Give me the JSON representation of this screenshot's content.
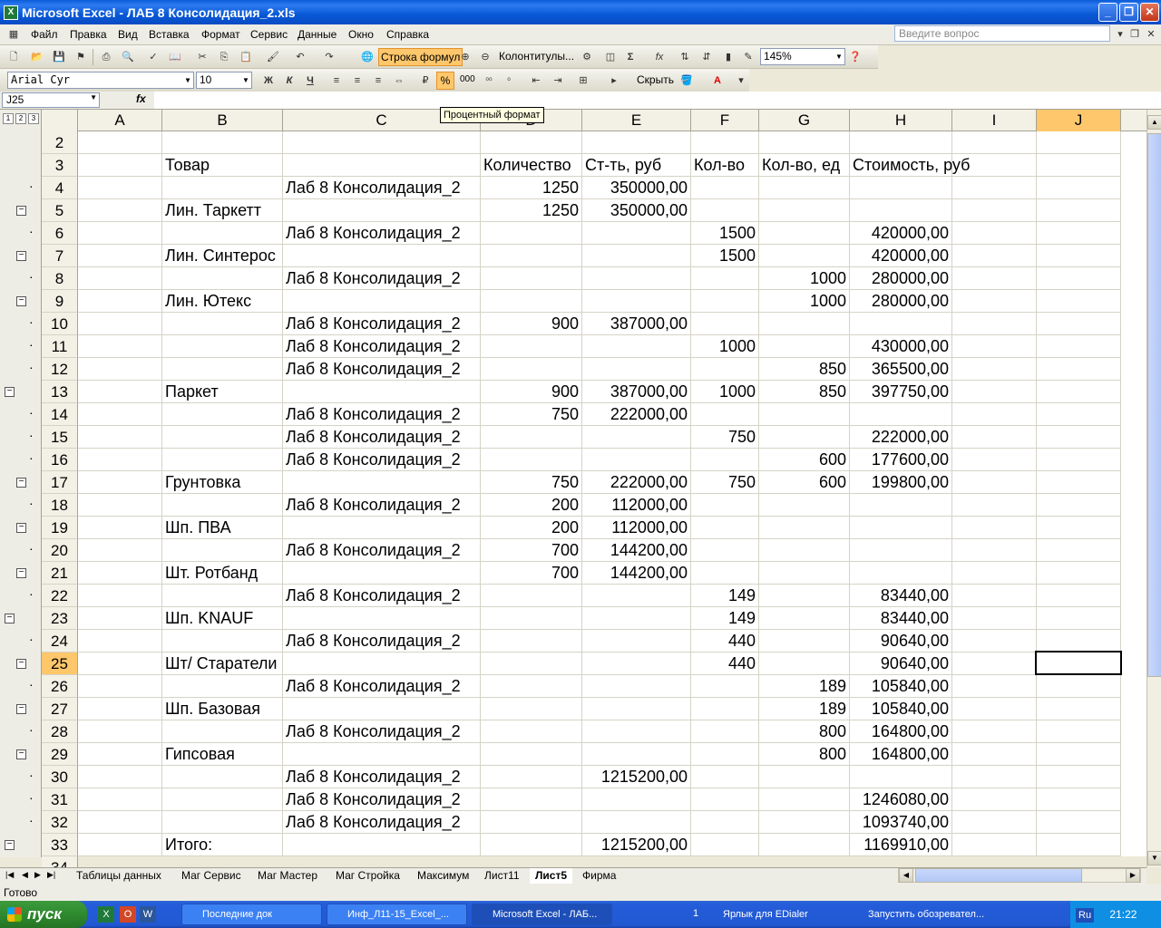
{
  "window": {
    "title": "Microsoft Excel - ЛАБ 8 Консолидация_2.xls"
  },
  "menu": {
    "items": [
      "Файл",
      "Правка",
      "Вид",
      "Вставка",
      "Формат",
      "Сервис",
      "Данные",
      "Окно",
      "Справка"
    ],
    "help_placeholder": "Введите вопрос"
  },
  "toolbar1": {
    "formula_bar_button": "Строка формул",
    "header_footer_button": "Колонтитулы...",
    "zoom": "145%"
  },
  "toolbar2": {
    "font_name": "Arial Cyr",
    "font_size": "10",
    "hide_button": "Скрыть",
    "percent_button": "%",
    "thousands_button": "000"
  },
  "formula_bar": {
    "name_box": "J25",
    "fx": "fx",
    "formula": ""
  },
  "tooltip": "Процентный формат",
  "outline_levels": [
    "1",
    "2",
    "3"
  ],
  "columns": [
    "A",
    "B",
    "C",
    "D",
    "E",
    "F",
    "G",
    "H",
    "I",
    "J"
  ],
  "rows": [
    {
      "n": "2",
      "B": "",
      "C": "",
      "D": "",
      "E": "",
      "F": "",
      "G": "",
      "H": ""
    },
    {
      "n": "3",
      "B": "Товар",
      "C": "",
      "D": "Количество",
      "E": "Ст-ть, руб",
      "F": "Кол-во",
      "G": "Кол-во, ед",
      "H": "Стоимость, руб"
    },
    {
      "n": "4",
      "B": "",
      "C": "Лаб 8 Консолидация_2",
      "D": "1250",
      "E": "350000,00",
      "F": "",
      "G": "",
      "H": ""
    },
    {
      "n": "5",
      "B": "Лин. Таркетт",
      "C": "",
      "D": "1250",
      "E": "350000,00",
      "F": "",
      "G": "",
      "H": ""
    },
    {
      "n": "6",
      "B": "",
      "C": "Лаб 8 Консолидация_2",
      "D": "",
      "E": "",
      "F": "1500",
      "G": "",
      "H": "420000,00"
    },
    {
      "n": "7",
      "B": "Лин. Синтерос",
      "C": "",
      "D": "",
      "E": "",
      "F": "1500",
      "G": "",
      "H": "420000,00"
    },
    {
      "n": "8",
      "B": "",
      "C": "Лаб 8 Консолидация_2",
      "D": "",
      "E": "",
      "F": "",
      "G": "1000",
      "H": "280000,00"
    },
    {
      "n": "9",
      "B": "Лин. Ютекс",
      "C": "",
      "D": "",
      "E": "",
      "F": "",
      "G": "1000",
      "H": "280000,00"
    },
    {
      "n": "10",
      "B": "",
      "C": "Лаб 8 Консолидация_2",
      "D": "900",
      "E": "387000,00",
      "F": "",
      "G": "",
      "H": ""
    },
    {
      "n": "11",
      "B": "",
      "C": "Лаб 8 Консолидация_2",
      "D": "",
      "E": "",
      "F": "1000",
      "G": "",
      "H": "430000,00"
    },
    {
      "n": "12",
      "B": "",
      "C": "Лаб 8 Консолидация_2",
      "D": "",
      "E": "",
      "F": "",
      "G": "850",
      "H": "365500,00"
    },
    {
      "n": "13",
      "B": "Паркет",
      "C": "",
      "D": "900",
      "E": "387000,00",
      "F": "1000",
      "G": "850",
      "H": "397750,00"
    },
    {
      "n": "14",
      "B": "",
      "C": "Лаб 8 Консолидация_2",
      "D": "750",
      "E": "222000,00",
      "F": "",
      "G": "",
      "H": ""
    },
    {
      "n": "15",
      "B": "",
      "C": "Лаб 8 Консолидация_2",
      "D": "",
      "E": "",
      "F": "750",
      "G": "",
      "H": "222000,00"
    },
    {
      "n": "16",
      "B": "",
      "C": "Лаб 8 Консолидация_2",
      "D": "",
      "E": "",
      "F": "",
      "G": "600",
      "H": "177600,00"
    },
    {
      "n": "17",
      "B": "Грунтовка",
      "C": "",
      "D": "750",
      "E": "222000,00",
      "F": "750",
      "G": "600",
      "H": "199800,00"
    },
    {
      "n": "18",
      "B": "",
      "C": "Лаб 8 Консолидация_2",
      "D": "200",
      "E": "112000,00",
      "F": "",
      "G": "",
      "H": ""
    },
    {
      "n": "19",
      "B": "Шп. ПВА",
      "C": "",
      "D": "200",
      "E": "112000,00",
      "F": "",
      "G": "",
      "H": ""
    },
    {
      "n": "20",
      "B": "",
      "C": "Лаб 8 Консолидация_2",
      "D": "700",
      "E": "144200,00",
      "F": "",
      "G": "",
      "H": ""
    },
    {
      "n": "21",
      "B": "Шт. Ротбанд",
      "C": "",
      "D": "700",
      "E": "144200,00",
      "F": "",
      "G": "",
      "H": ""
    },
    {
      "n": "22",
      "B": "",
      "C": "Лаб 8 Консолидация_2",
      "D": "",
      "E": "",
      "F": "149",
      "G": "",
      "H": "83440,00"
    },
    {
      "n": "23",
      "B": "Шп. KNAUF",
      "C": "",
      "D": "",
      "E": "",
      "F": "149",
      "G": "",
      "H": "83440,00"
    },
    {
      "n": "24",
      "B": "",
      "C": "Лаб 8 Консолидация_2",
      "D": "",
      "E": "",
      "F": "440",
      "G": "",
      "H": "90640,00"
    },
    {
      "n": "25",
      "B": "Шт/ Старатели",
      "C": "",
      "D": "",
      "E": "",
      "F": "440",
      "G": "",
      "H": "90640,00"
    },
    {
      "n": "26",
      "B": "",
      "C": "Лаб 8 Консолидация_2",
      "D": "",
      "E": "",
      "F": "",
      "G": "189",
      "H": "105840,00"
    },
    {
      "n": "27",
      "B": "Шп. Базовая",
      "C": "",
      "D": "",
      "E": "",
      "F": "",
      "G": "189",
      "H": "105840,00"
    },
    {
      "n": "28",
      "B": "",
      "C": "Лаб 8 Консолидация_2",
      "D": "",
      "E": "",
      "F": "",
      "G": "800",
      "H": "164800,00"
    },
    {
      "n": "29",
      "B": "Гипсовая",
      "C": "",
      "D": "",
      "E": "",
      "F": "",
      "G": "800",
      "H": "164800,00"
    },
    {
      "n": "30",
      "B": "",
      "C": "Лаб 8 Консолидация_2",
      "D": "",
      "E": "1215200,00",
      "F": "",
      "G": "",
      "H": ""
    },
    {
      "n": "31",
      "B": "",
      "C": "Лаб 8 Консолидация_2",
      "D": "",
      "E": "",
      "F": "",
      "G": "",
      "H": "1246080,00"
    },
    {
      "n": "32",
      "B": "",
      "C": "Лаб 8 Консолидация_2",
      "D": "",
      "E": "",
      "F": "",
      "G": "",
      "H": "1093740,00"
    },
    {
      "n": "33",
      "B": "Итого:",
      "C": "",
      "D": "",
      "E": "1215200,00",
      "F": "",
      "G": "",
      "H": "1169910,00"
    },
    {
      "n": "34",
      "B": "",
      "C": "",
      "D": "",
      "E": "",
      "F": "",
      "G": "",
      "H": ""
    }
  ],
  "sheet_tabs": [
    "Таблицы данных",
    "Маг Сервис",
    "Маг Мастер",
    "Маг Стройка",
    "Максимум",
    "Лист11",
    "Лист5",
    "Фирма"
  ],
  "active_sheet": "Лист5",
  "status": "Готово",
  "taskbar": {
    "start": "пуск",
    "buttons": [
      "Последние док",
      "Инф_Л11-15_Excel_...",
      "Microsoft Excel - ЛАБ...",
      "Ярлык для EDialer",
      "Запустить обозревател..."
    ],
    "group_count": "1",
    "lang": "Ru",
    "clock": "21:22"
  },
  "colors": {
    "accent": "#FFC76B",
    "title_blue": "#0A5CD8",
    "taskbar_blue": "#245DDA",
    "start_green": "#3C9A3C"
  }
}
